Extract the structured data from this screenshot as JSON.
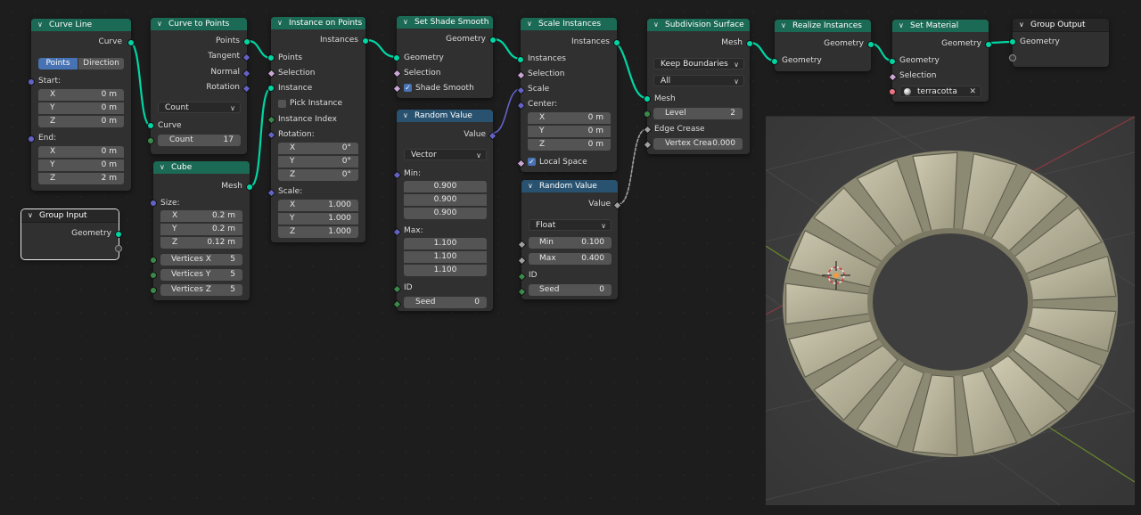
{
  "nodes": {
    "curve_line": {
      "title": "Curve Line",
      "output": "Curve",
      "mode_options": [
        "Points",
        "Direction"
      ],
      "mode_selected": "Points",
      "start_label": "Start:",
      "start": [
        {
          "axis": "X",
          "value": "0 m"
        },
        {
          "axis": "Y",
          "value": "0 m"
        },
        {
          "axis": "Z",
          "value": "0 m"
        }
      ],
      "end_label": "End:",
      "end": [
        {
          "axis": "X",
          "value": "0 m"
        },
        {
          "axis": "Y",
          "value": "0 m"
        },
        {
          "axis": "Z",
          "value": "2 m"
        }
      ]
    },
    "curve_to_points": {
      "title": "Curve to Points",
      "outputs": [
        "Points",
        "Tangent",
        "Normal",
        "Rotation"
      ],
      "mode": "Count",
      "input_curve": "Curve",
      "count_label": "Count",
      "count_value": "17"
    },
    "cube": {
      "title": "Cube",
      "output": "Mesh",
      "size_label": "Size:",
      "size": [
        {
          "axis": "X",
          "value": "0.2 m"
        },
        {
          "axis": "Y",
          "value": "0.2 m"
        },
        {
          "axis": "Z",
          "value": "0.12 m"
        }
      ],
      "vertices": [
        {
          "label": "Vertices X",
          "value": "5"
        },
        {
          "label": "Vertices Y",
          "value": "5"
        },
        {
          "label": "Vertices Z",
          "value": "5"
        }
      ]
    },
    "group_input": {
      "title": "Group Input",
      "output": "Geometry"
    },
    "instance_on_points": {
      "title": "Instance on Points",
      "output": "Instances",
      "inputs": [
        "Points",
        "Selection",
        "Instance"
      ],
      "pick_instance": "Pick Instance",
      "instance_index": "Instance Index",
      "rotation_label": "Rotation:",
      "rotation": [
        {
          "axis": "X",
          "value": "0°"
        },
        {
          "axis": "Y",
          "value": "0°"
        },
        {
          "axis": "Z",
          "value": "0°"
        }
      ],
      "scale_label": "Scale:",
      "scale": [
        {
          "axis": "X",
          "value": "1.000"
        },
        {
          "axis": "Y",
          "value": "1.000"
        },
        {
          "axis": "Z",
          "value": "1.000"
        }
      ]
    },
    "set_shade_smooth": {
      "title": "Set Shade Smooth",
      "output": "Geometry",
      "inputs": [
        "Geometry",
        "Selection"
      ],
      "shade_smooth": "Shade Smooth"
    },
    "random_value_vector": {
      "title": "Random Value",
      "output": "Value",
      "type": "Vector",
      "min_label": "Min:",
      "min": [
        "0.900",
        "0.900",
        "0.900"
      ],
      "max_label": "Max:",
      "max": [
        "1.100",
        "1.100",
        "1.100"
      ],
      "id_label": "ID",
      "seed_label": "Seed",
      "seed_value": "0"
    },
    "scale_instances": {
      "title": "Scale Instances",
      "output": "Instances",
      "inputs": [
        "Instances",
        "Selection",
        "Scale"
      ],
      "center_label": "Center:",
      "center": [
        {
          "axis": "X",
          "value": "0 m"
        },
        {
          "axis": "Y",
          "value": "0 m"
        },
        {
          "axis": "Z",
          "value": "0 m"
        }
      ],
      "local_space": "Local Space"
    },
    "random_value_float": {
      "title": "Random Value",
      "output": "Value",
      "type": "Float",
      "min_label": "Min",
      "min_value": "0.100",
      "max_label": "Max",
      "max_value": "0.400",
      "id_label": "ID",
      "seed_label": "Seed",
      "seed_value": "0"
    },
    "subdivision_surface": {
      "title": "Subdivision Surface",
      "output": "Mesh",
      "boundary": "Keep Boundaries",
      "uv_smooth": "All",
      "input_mesh": "Mesh",
      "level_label": "Level",
      "level_value": "2",
      "edge_crease": "Edge Crease",
      "vertex_crease_label": "Vertex Crea",
      "vertex_crease_value": "0.000"
    },
    "realize_instances": {
      "title": "Realize Instances",
      "output": "Geometry",
      "input": "Geometry"
    },
    "set_material": {
      "title": "Set Material",
      "output": "Geometry",
      "inputs": [
        "Geometry",
        "Selection"
      ],
      "material": "terracotta"
    },
    "group_output": {
      "title": "Group Output",
      "input": "Geometry"
    }
  },
  "colors": {
    "geometry_header": "#1b6a55",
    "utility_header": "#28526f",
    "geometry_socket": "#00d6a3",
    "vector_socket": "#6363c7",
    "float_socket": "#a1a1a1",
    "integer_socket": "#3b8a4a",
    "boolean_socket": "#cca6d6",
    "material_socket": "#eb7582",
    "toggle_on": "#4772b3",
    "stone": "#b9b49a"
  }
}
